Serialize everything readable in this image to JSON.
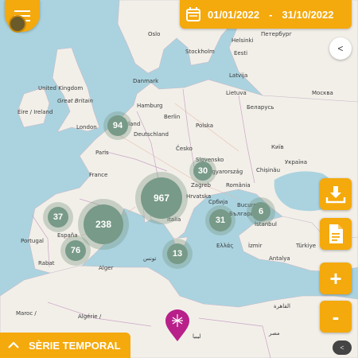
{
  "date_range": {
    "start": "01/01/2022",
    "separator": "-",
    "end": "31/10/2022"
  },
  "controls": {
    "collapse": "<",
    "zoom_in": "+",
    "zoom_out": "-",
    "attribution": "<"
  },
  "serie_temporal": {
    "label": "SÈRIE TEMPORAL"
  },
  "clusters": [
    {
      "id": "c94",
      "count": "94"
    },
    {
      "id": "c967",
      "count": "967"
    },
    {
      "id": "c30",
      "count": "30"
    },
    {
      "id": "c37",
      "count": "37"
    },
    {
      "id": "c238",
      "count": "238"
    },
    {
      "id": "c31",
      "count": "31"
    },
    {
      "id": "c6",
      "count": "6"
    },
    {
      "id": "c76",
      "count": "76"
    },
    {
      "id": "c13",
      "count": "13"
    }
  ],
  "place_labels": {
    "oslo": "Oslo",
    "helsinki": "Helsinki",
    "peterburg": "Петербург",
    "stockholm": "Stockholm",
    "eesti": "Eesti",
    "latvija": "Latvija",
    "danmark": "Danmark",
    "lietuva": "Lietuva",
    "moskva": "Москва",
    "uk": "United Kingdom",
    "gb": "Great Britain",
    "eire": "Éire / Ireland",
    "hamburg": "Hamburg",
    "berlin": "Berlin",
    "belarus": "Беларусь",
    "london": "London",
    "nederland": "Nederland",
    "deutschland": "Deutschland",
    "polska": "Polska",
    "paris": "Paris",
    "cesko": "Česko",
    "kyiv": "Київ",
    "slovensko": "Slovensko",
    "ukraina": "Україна",
    "france": "France",
    "magyarorszag": "Magyarország",
    "chisinau": "Chișinău",
    "zagreb": "Zagreb",
    "romania": "România",
    "hrvatska": "Hrvatska",
    "srbija": "Србија",
    "bucuresti": "București",
    "italia": "Italia",
    "blgariya": "България",
    "espana": "España",
    "portugal": "Portugal",
    "istanbul": "İstanbul",
    "ellas": "Ελλάς",
    "izmir": "İzmir",
    "turkiye": "Türkiye",
    "antalya": "Antalya",
    "rabat": "Rabat",
    "alger": "Alger",
    "tunis": "تونس",
    "maroc": "Maroc /",
    "algerie": "Algérie /",
    "libya": "ليبيا",
    "misr": "مصر",
    "qahira": "القاهرة"
  },
  "colors": {
    "accent": "#f4a90c",
    "cluster": "#789a88",
    "sea": "#aad3df",
    "land": "#f2efe9",
    "pin": "#b8208a"
  }
}
